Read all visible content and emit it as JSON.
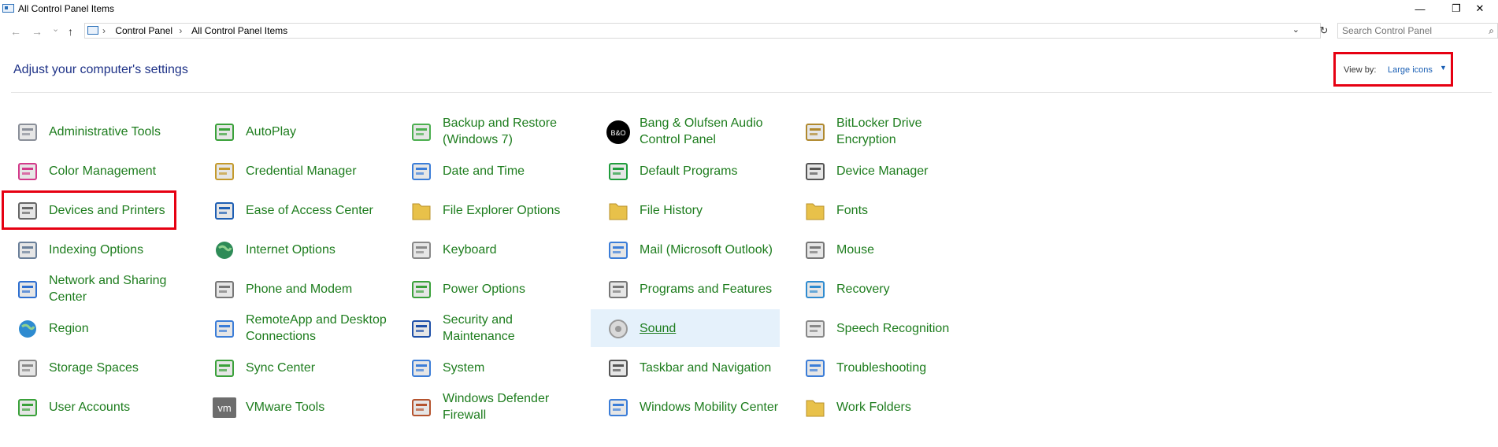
{
  "window": {
    "title": "All Control Panel Items",
    "minimize_label": "—",
    "restore_label": "❐",
    "close_label": "✕"
  },
  "nav": {
    "back_icon": "←",
    "forward_icon": "→",
    "recent_icon": "⌄",
    "up_icon": "↑",
    "breadcrumbs": [
      "Control Panel",
      "All Control Panel Items"
    ],
    "breadcrumb_sep": "›",
    "dropdown_icon": "⌄",
    "refresh_icon": "↻",
    "search_placeholder": "Search Control Panel",
    "search_icon": "⌕"
  },
  "header": {
    "title": "Adjust your computer's settings",
    "view_by_label": "View by:",
    "view_by_value": "Large icons",
    "view_by_caret": "▼"
  },
  "items": [
    {
      "label": "Administrative Tools",
      "icon": "admin-tools-icon",
      "color": "#8a8f99"
    },
    {
      "label": "AutoPlay",
      "icon": "autoplay-icon",
      "color": "#3aa13a"
    },
    {
      "label": "Backup and Restore (Windows 7)",
      "icon": "backup-icon",
      "color": "#4caf50"
    },
    {
      "label": "Bang & Olufsen Audio Control Panel",
      "icon": "bang-olufsen-icon",
      "color": "#000000"
    },
    {
      "label": "BitLocker Drive Encryption",
      "icon": "bitlocker-icon",
      "color": "#b0892e"
    },
    {
      "label": "Color Management",
      "icon": "color-management-icon",
      "color": "#d33a8a"
    },
    {
      "label": "Credential Manager",
      "icon": "credential-manager-icon",
      "color": "#c49a2c"
    },
    {
      "label": "Date and Time",
      "icon": "date-time-icon",
      "color": "#3b7dd8"
    },
    {
      "label": "Default Programs",
      "icon": "default-programs-icon",
      "color": "#1f9d3c"
    },
    {
      "label": "Device Manager",
      "icon": "device-manager-icon",
      "color": "#555555"
    },
    {
      "label": "Devices and Printers",
      "icon": "printer-icon",
      "color": "#666666"
    },
    {
      "label": "Ease of Access Center",
      "icon": "ease-of-access-icon",
      "color": "#1e5fb4"
    },
    {
      "label": "File Explorer Options",
      "icon": "folder-options-icon",
      "color": "#e8c14a"
    },
    {
      "label": "File History",
      "icon": "file-history-icon",
      "color": "#e8c14a"
    },
    {
      "label": "Fonts",
      "icon": "fonts-icon",
      "color": "#e8c14a"
    },
    {
      "label": "Indexing Options",
      "icon": "indexing-icon",
      "color": "#6a7f99"
    },
    {
      "label": "Internet Options",
      "icon": "internet-options-icon",
      "color": "#2e8b57"
    },
    {
      "label": "Keyboard",
      "icon": "keyboard-icon",
      "color": "#888888"
    },
    {
      "label": "Mail (Microsoft Outlook)",
      "icon": "mail-icon",
      "color": "#3b7dd8"
    },
    {
      "label": "Mouse",
      "icon": "mouse-icon",
      "color": "#777777"
    },
    {
      "label": "Network and Sharing Center",
      "icon": "network-icon",
      "color": "#2e6fd0"
    },
    {
      "label": "Phone and Modem",
      "icon": "phone-modem-icon",
      "color": "#777777"
    },
    {
      "label": "Power Options",
      "icon": "power-options-icon",
      "color": "#3aa13a"
    },
    {
      "label": "Programs and Features",
      "icon": "programs-features-icon",
      "color": "#777777"
    },
    {
      "label": "Recovery",
      "icon": "recovery-icon",
      "color": "#2e8bd0"
    },
    {
      "label": "Region",
      "icon": "region-icon",
      "color": "#2e8bd0"
    },
    {
      "label": "RemoteApp and Desktop Connections",
      "icon": "remoteapp-icon",
      "color": "#3b7dd8"
    },
    {
      "label": "Security and Maintenance",
      "icon": "flag-icon",
      "color": "#1e4fa8"
    },
    {
      "label": "Sound",
      "icon": "speaker-icon",
      "color": "#999999"
    },
    {
      "label": "Speech Recognition",
      "icon": "microphone-icon",
      "color": "#888888"
    },
    {
      "label": "Storage Spaces",
      "icon": "storage-spaces-icon",
      "color": "#888888"
    },
    {
      "label": "Sync Center",
      "icon": "sync-center-icon",
      "color": "#3aa13a"
    },
    {
      "label": "System",
      "icon": "system-icon",
      "color": "#3b7dd8"
    },
    {
      "label": "Taskbar and Navigation",
      "icon": "taskbar-icon",
      "color": "#555555"
    },
    {
      "label": "Troubleshooting",
      "icon": "troubleshooting-icon",
      "color": "#3b7dd8"
    },
    {
      "label": "User Accounts",
      "icon": "user-accounts-icon",
      "color": "#3aa13a"
    },
    {
      "label": "VMware Tools",
      "icon": "vmware-icon",
      "color": "#6d6d6d"
    },
    {
      "label": "Windows Defender Firewall",
      "icon": "firewall-icon",
      "color": "#b5532e"
    },
    {
      "label": "Windows Mobility Center",
      "icon": "mobility-center-icon",
      "color": "#3b7dd8"
    },
    {
      "label": "Work Folders",
      "icon": "work-folders-icon",
      "color": "#e8c14a"
    }
  ],
  "vmware_icon_text": "vm",
  "bo_icon_text": "B&O"
}
